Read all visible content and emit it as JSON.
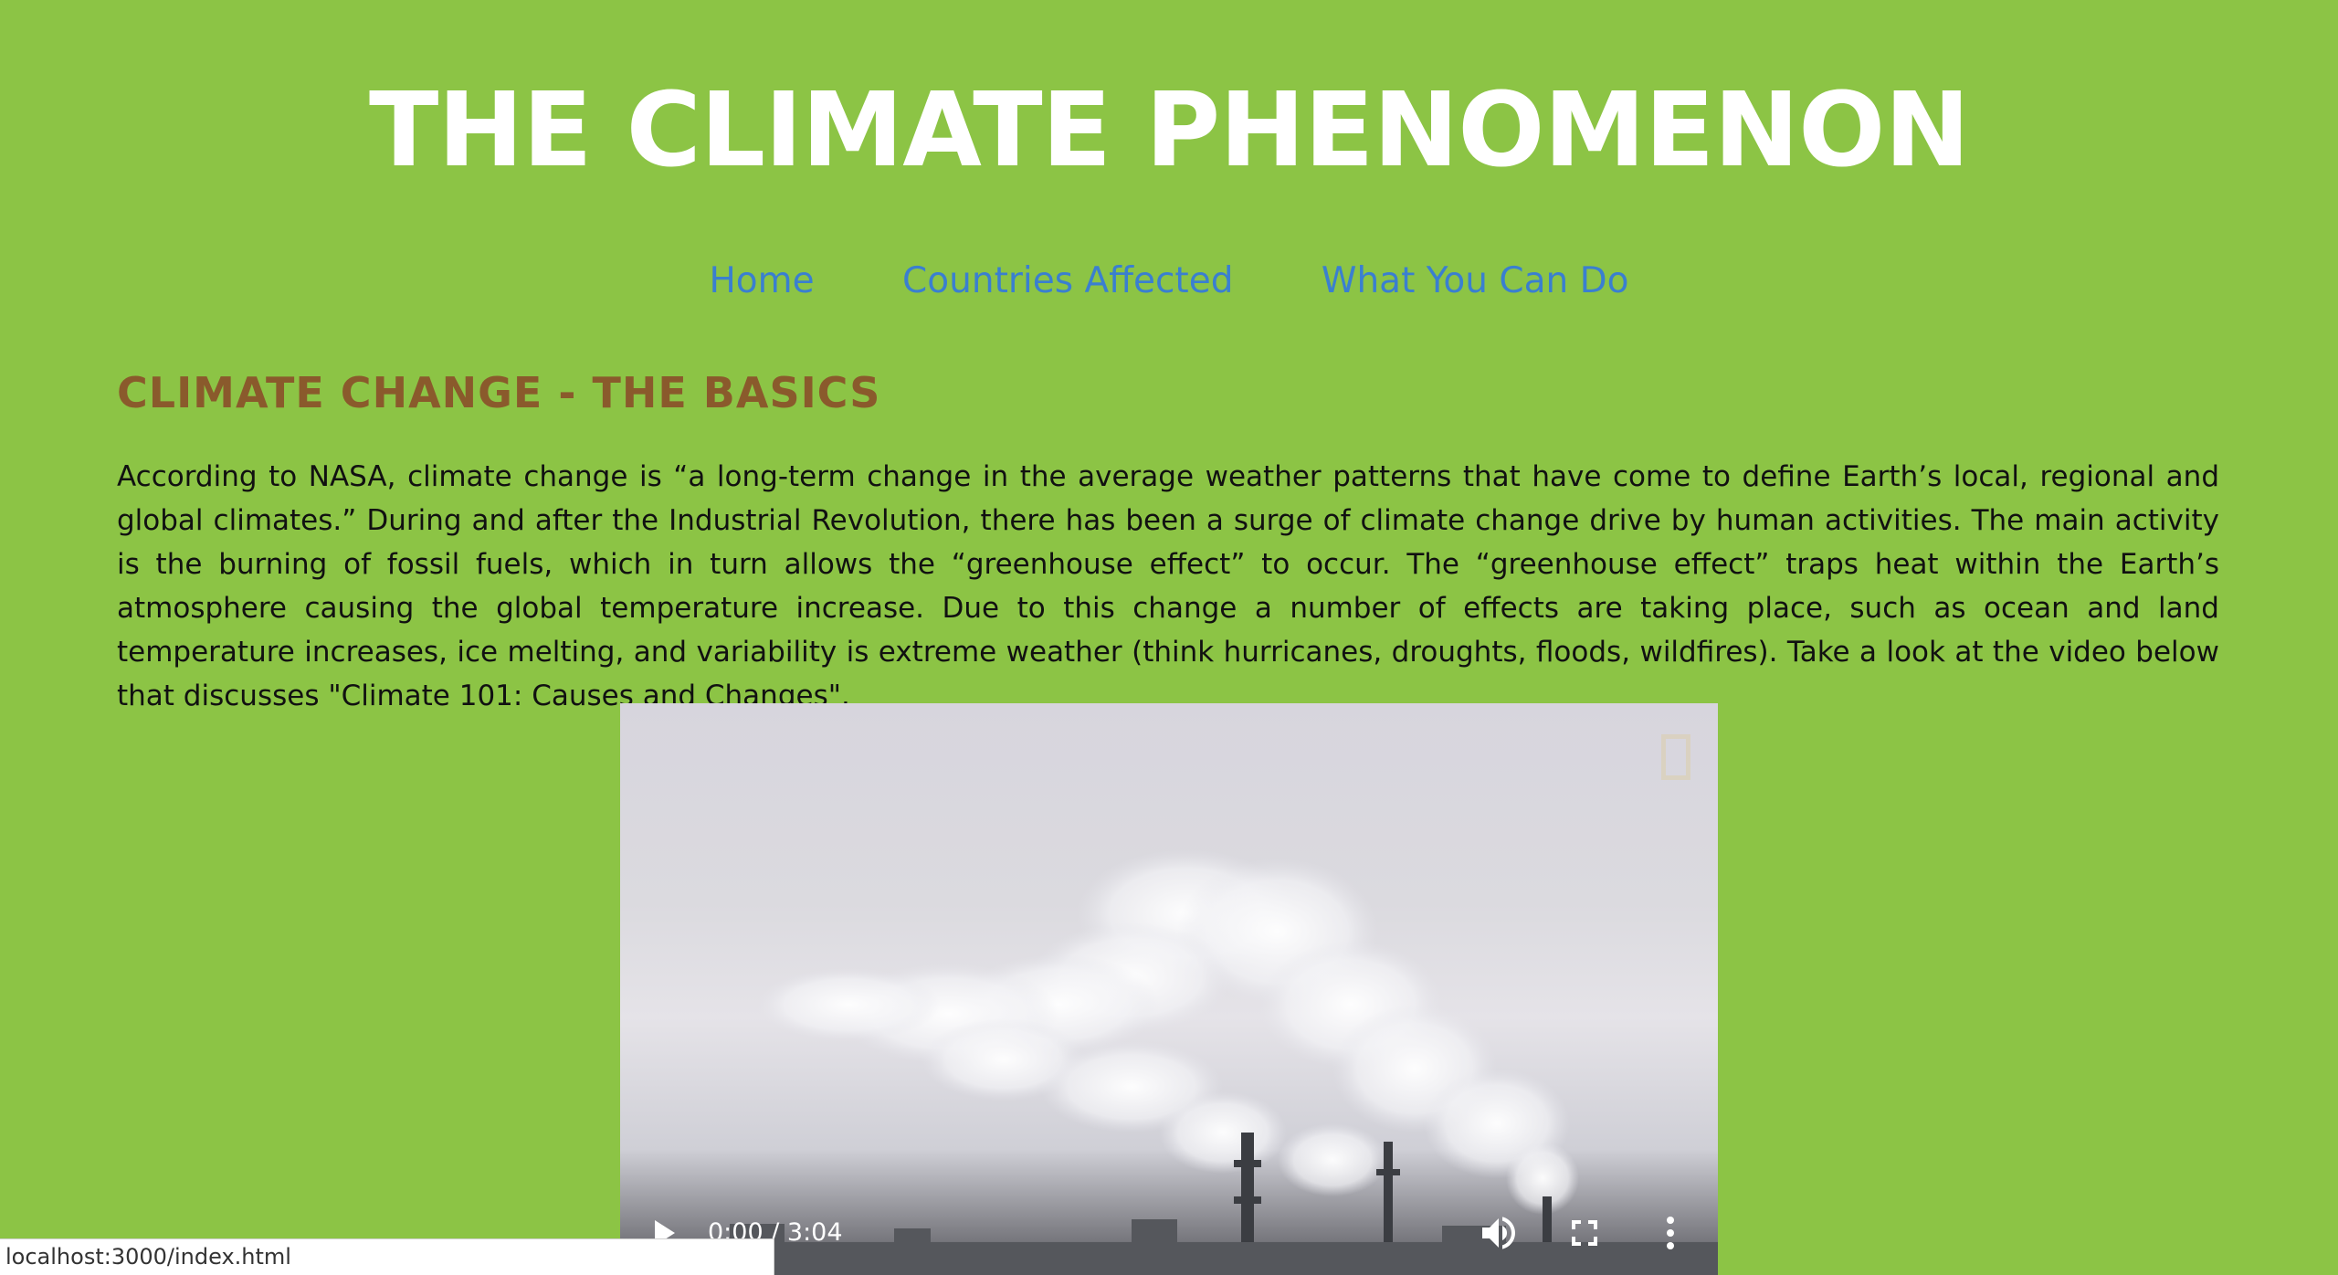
{
  "header": {
    "title": "THE CLIMATE PHENOMENON"
  },
  "nav": {
    "items": [
      {
        "label": "Home"
      },
      {
        "label": "Countries Affected"
      },
      {
        "label": "What You Can Do"
      }
    ]
  },
  "main": {
    "heading": "CLIMATE CHANGE - THE BASICS",
    "paragraph": "According to NASA, climate change is “a long-term change in the average weather patterns that have come to define Earth’s local, regional and global climates.” During and after the Industrial Revolution, there has been a surge of climate change drive by human activities. The main activity is the burning of fossil fuels, which in turn allows the “greenhouse effect” to occur. The “greenhouse effect” traps heat within the Earth’s atmosphere causing the global temperature increase. Due to this change a number of effects are taking place, such as ocean and land temperature increases, ice melting, and variability is extreme weather (think hurricanes, droughts, floods, wildfires). Take a look at the video below that discusses \"Climate 101: Causes and Changes\"."
  },
  "video": {
    "time": "0:00 / 3:04",
    "icons": [
      "play-icon",
      "volume-icon",
      "fullscreen-icon",
      "more-options-icon"
    ]
  },
  "status_bar": {
    "url": "localhost:3000/index.html"
  },
  "colors": {
    "background": "#8cc445",
    "title": "#ffffff",
    "nav_link": "#3a7fd0",
    "heading": "#8a5a2c",
    "text": "#111111"
  }
}
